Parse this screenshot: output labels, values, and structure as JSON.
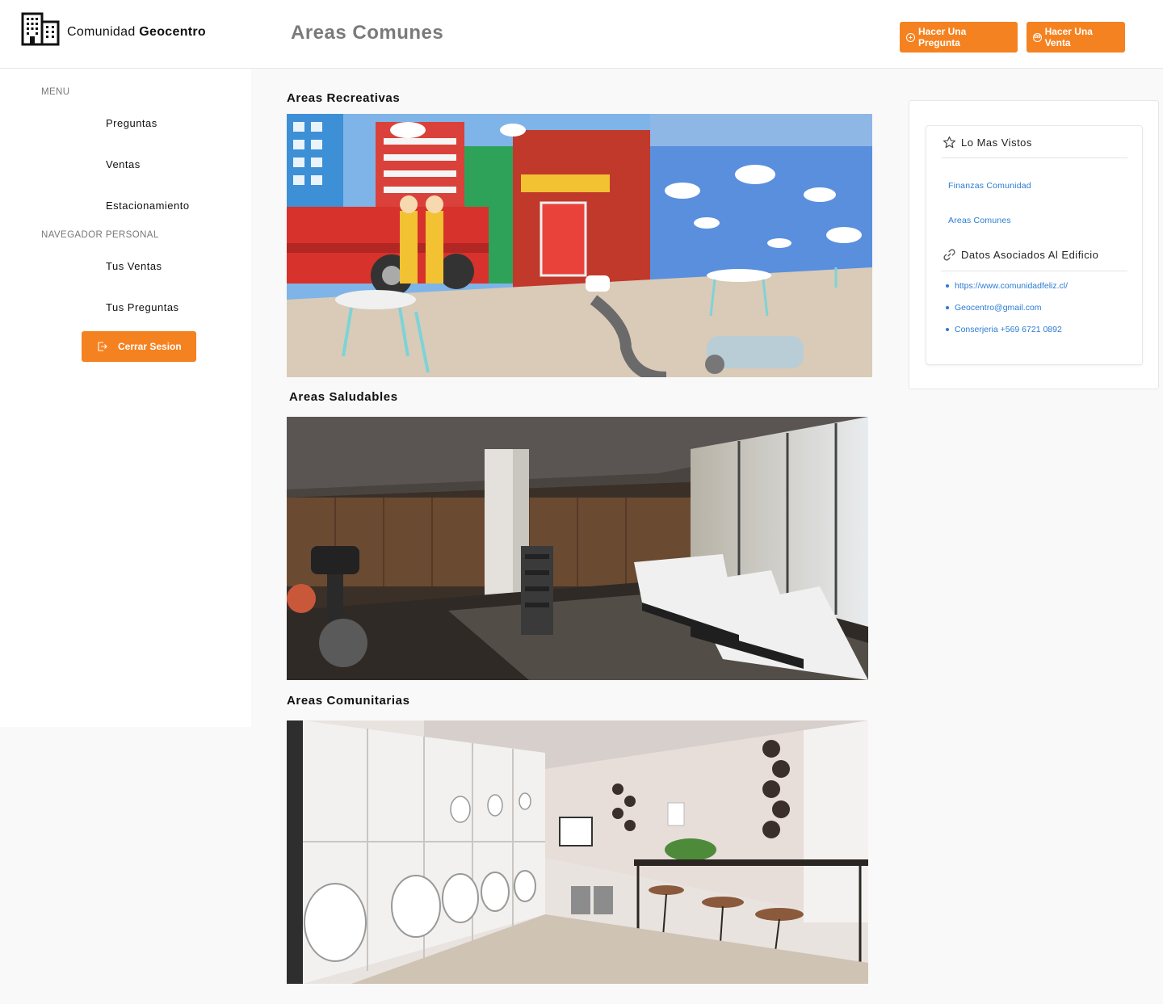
{
  "brand": {
    "name_prefix": "Comunidad",
    "name_bold": "Geocentro"
  },
  "header": {
    "title": "Areas Comunes",
    "ask_button": "Hacer Una Pregunta",
    "sell_button": "Hacer Una Venta"
  },
  "sidebar": {
    "menu_heading": "MENU",
    "menu_items": [
      {
        "label": "Preguntas"
      },
      {
        "label": "Ventas"
      },
      {
        "label": "Estacionamiento"
      }
    ],
    "personal_heading": "NAVEGADOR PERSONAL",
    "personal_items": [
      {
        "label": "Tus Ventas"
      },
      {
        "label": "Tus Preguntas"
      }
    ],
    "logout_label": "Cerrar Sesion"
  },
  "sections": [
    {
      "title": "Areas Recreativas"
    },
    {
      "title": "Areas Saludables"
    },
    {
      "title": "Areas Comunitarias"
    }
  ],
  "side_panel": {
    "most_viewed_title": "Lo Mas Vistos",
    "most_viewed_links": [
      "Finanzas Comunidad",
      "Areas Comunes"
    ],
    "associated_title": "Datos Asociados Al Edificio",
    "associated_items": [
      "https://www.comunidadfeliz.cl/",
      "Geocentro@gmail.com",
      "Conserjeria +569 6721 0892"
    ]
  },
  "colors": {
    "accent": "#f58220",
    "link": "#2b7bd1",
    "title_gray": "#7a7a7a"
  },
  "icons": {
    "brand": "building-icon",
    "ask": "plus-circle-icon",
    "sell": "coin-icon",
    "logout": "logout-icon",
    "most_viewed": "star-icon",
    "associated": "link-icon"
  }
}
